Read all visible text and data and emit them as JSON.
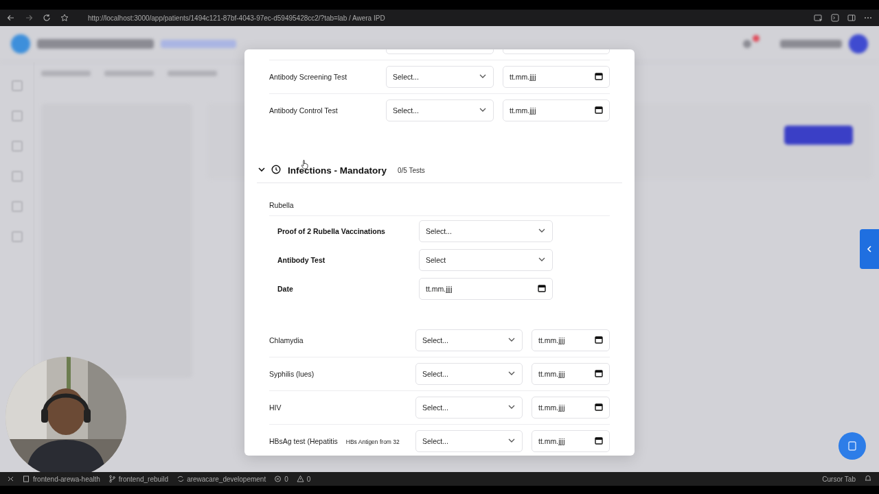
{
  "browser": {
    "url": "http://localhost:3000/app/patients/1494c121-87bf-4043-97ec-d59495428cc2/?tab=lab / Awera IPD"
  },
  "modal": {
    "top_rows": [
      {
        "label": "Antibody Screening Test",
        "select": "Select...",
        "date": "tt.mm.jjjj"
      },
      {
        "label": "Antibody Control Test",
        "select": "Select...",
        "date": "tt.mm.jjjj"
      }
    ],
    "section": {
      "title": "Infections - Mandatory",
      "count": "0/5 Tests",
      "expanded": true,
      "subgroup": {
        "title": "Rubella",
        "rows": [
          {
            "kind": "select",
            "label": "Proof of 2 Rubella Vaccinations",
            "value": "Select..."
          },
          {
            "kind": "select",
            "label": "Antibody Test",
            "value": "Select"
          },
          {
            "kind": "date",
            "label": "Date",
            "value": "tt.mm.jjjj"
          }
        ]
      },
      "rows": [
        {
          "label": "Chlamydia",
          "select": "Select...",
          "date": "tt.mm.jjjj"
        },
        {
          "label": "Syphilis (lues)",
          "select": "Select...",
          "date": "tt.mm.jjjj"
        },
        {
          "label": "HIV",
          "select": "Select...",
          "date": "tt.mm.jjjj"
        },
        {
          "label": "HBsAg test (Hepatitis",
          "note": "HBs Antigen from 32",
          "select": "Select...",
          "date": "tt.mm.jjjj"
        }
      ]
    }
  },
  "status_bar": {
    "items": [
      {
        "kind": "folder",
        "text": "frontend-arewa-health"
      },
      {
        "kind": "branch",
        "text": "frontend_rebuild"
      },
      {
        "kind": "sync",
        "text": "arewacare_developement"
      },
      {
        "kind": "errors",
        "text": "0"
      },
      {
        "kind": "warnings",
        "text": "0"
      }
    ],
    "right": "Cursor Tab"
  }
}
